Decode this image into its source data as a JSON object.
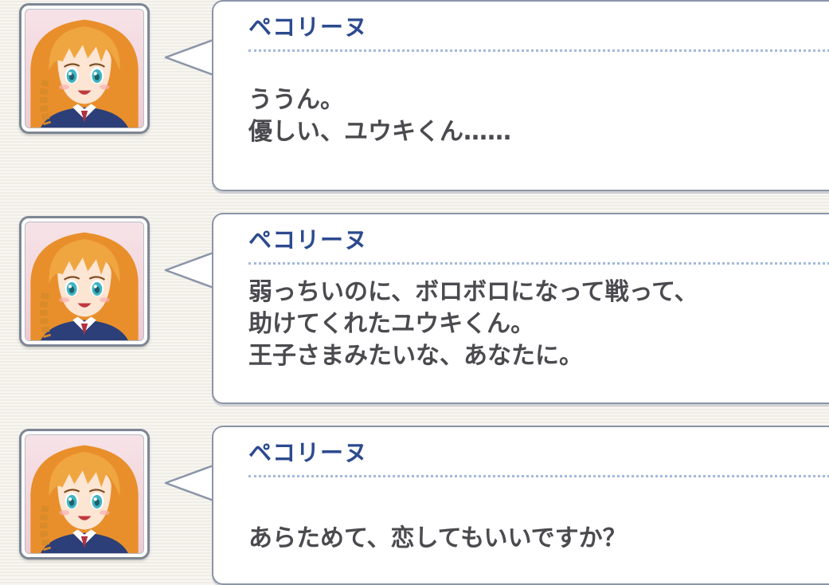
{
  "messages": [
    {
      "speaker": "ペコリーヌ",
      "lines": [
        "ううん。",
        "優しい、ユウキくん……"
      ]
    },
    {
      "speaker": "ペコリーヌ",
      "lines": [
        "弱っちいのに、ボロボロになって戦って、",
        "助けてくれたユウキくん。",
        "王子さまみたいな、あなたに。"
      ]
    },
    {
      "speaker": "ペコリーヌ",
      "lines": [
        "あらためて、恋してもいいですか？"
      ]
    }
  ],
  "avatar": {
    "character": "ペコリーヌ",
    "hair_color": "#f0a640",
    "eye_color": "#3fb4c2",
    "uniform_color": "#2c3f78",
    "ribbon_color": "#b23040"
  },
  "colors": {
    "speaker_name": "#2c4a8f",
    "body_text": "#4a4a4f",
    "divider": "#a3b9dc",
    "bubble_border": "#8c95a8",
    "background": "#f3f1ea"
  }
}
